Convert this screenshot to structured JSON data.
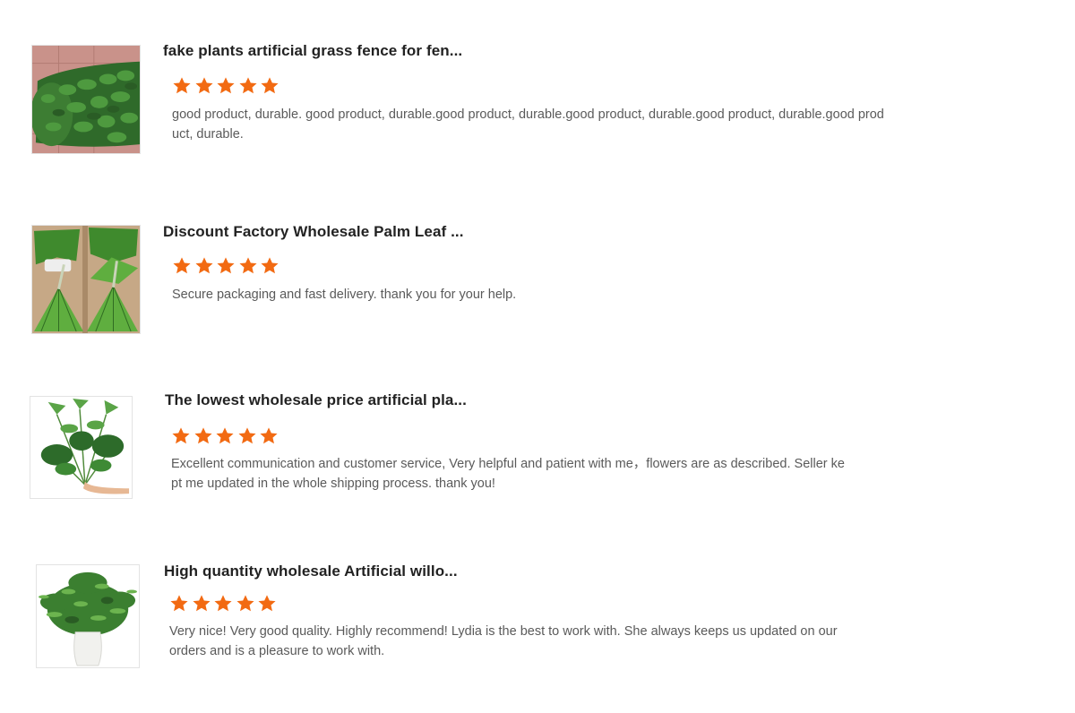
{
  "reviews": [
    {
      "product_title": "fake plants artificial grass fence for fen...",
      "rating": 5,
      "rating_max": 5,
      "comment": "good product, durable. good product, durable.good product, durable.good product, durable.good product, durable.good product, durable.",
      "image": "artificial-hedge-roll-photo"
    },
    {
      "product_title": "Discount Factory Wholesale Palm Leaf ...",
      "rating": 5,
      "rating_max": 5,
      "comment": "Secure packaging and fast delivery. thank you for your help.",
      "image": "palm-leaves-photo"
    },
    {
      "product_title": "The lowest wholesale price artificial pla...",
      "rating": 5,
      "rating_max": 5,
      "comment": "Excellent communication and customer service, Very helpful and patient with me，flowers are as described. Seller kept me updated in the whole shipping process. thank you!",
      "image": "tropical-leaf-bunch-photo"
    },
    {
      "product_title": "High quantity wholesale Artificial willo...",
      "rating": 5,
      "rating_max": 5,
      "comment": "Very nice! Very good quality.  Highly recommend! Lydia is the best to work with. She always keeps us updated on our orders and is a pleasure to work with.",
      "image": "willow-in-vase-photo"
    }
  ],
  "colors": {
    "star": "#f26a12",
    "title": "#222222",
    "comment": "#5a5a5a",
    "background": "#ffffff"
  }
}
